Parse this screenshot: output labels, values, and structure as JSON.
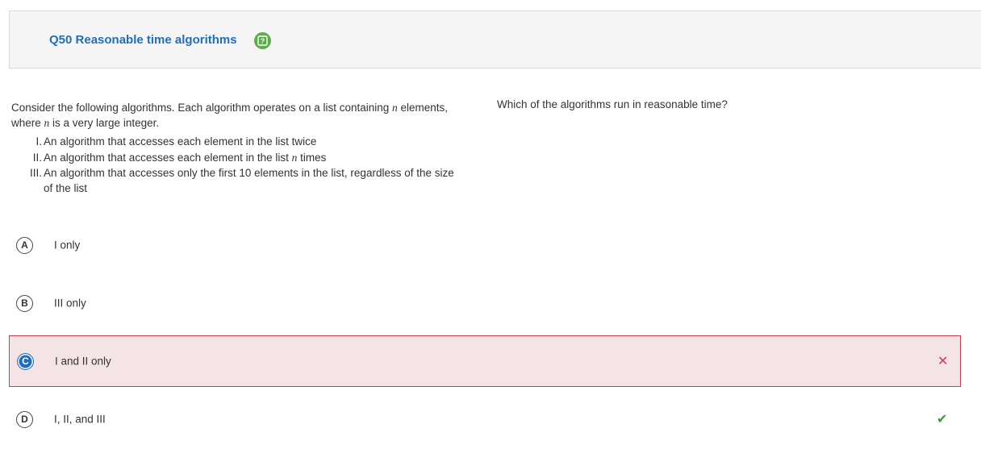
{
  "header": {
    "title": "Q50 Reasonable time algorithms",
    "help_icon": "question-mark-icon"
  },
  "stem": {
    "intro_part1": "Consider the following algorithms. Each algorithm operates on a list containing ",
    "var_n": "n",
    "intro_part2": " elements, where ",
    "intro_part3": " is a very large integer.",
    "items": [
      {
        "num": "I.",
        "text_a": "An algorithm that accesses each element in the list twice",
        "var": "",
        "text_b": ""
      },
      {
        "num": "II.",
        "text_a": "An algorithm that accesses each element in the list ",
        "var": "n",
        "text_b": " times"
      },
      {
        "num": "III.",
        "text_a": "An algorithm that accesses only the first 10 elements in the list, regardless of the size of the list",
        "var": "",
        "text_b": ""
      }
    ]
  },
  "prompt": "Which of the algorithms run in reasonable time?",
  "choices": [
    {
      "letter": "A",
      "text": "I only"
    },
    {
      "letter": "B",
      "text": "III only"
    },
    {
      "letter": "C",
      "text": "I and II only"
    },
    {
      "letter": "D",
      "text": "I, II, and III"
    }
  ],
  "selected_choice": "C",
  "correct_choice": "D",
  "marks": {
    "wrong_icon": "close-x-icon",
    "right_icon": "checkmark-icon",
    "wrong_glyph": "✕",
    "right_glyph": "✔"
  },
  "colors": {
    "accent": "#1f6fbf",
    "wrong": "#c4414e",
    "wrong_bg": "#f4e4e6",
    "correct": "#3c9a3c",
    "help": "#5aae4a"
  }
}
